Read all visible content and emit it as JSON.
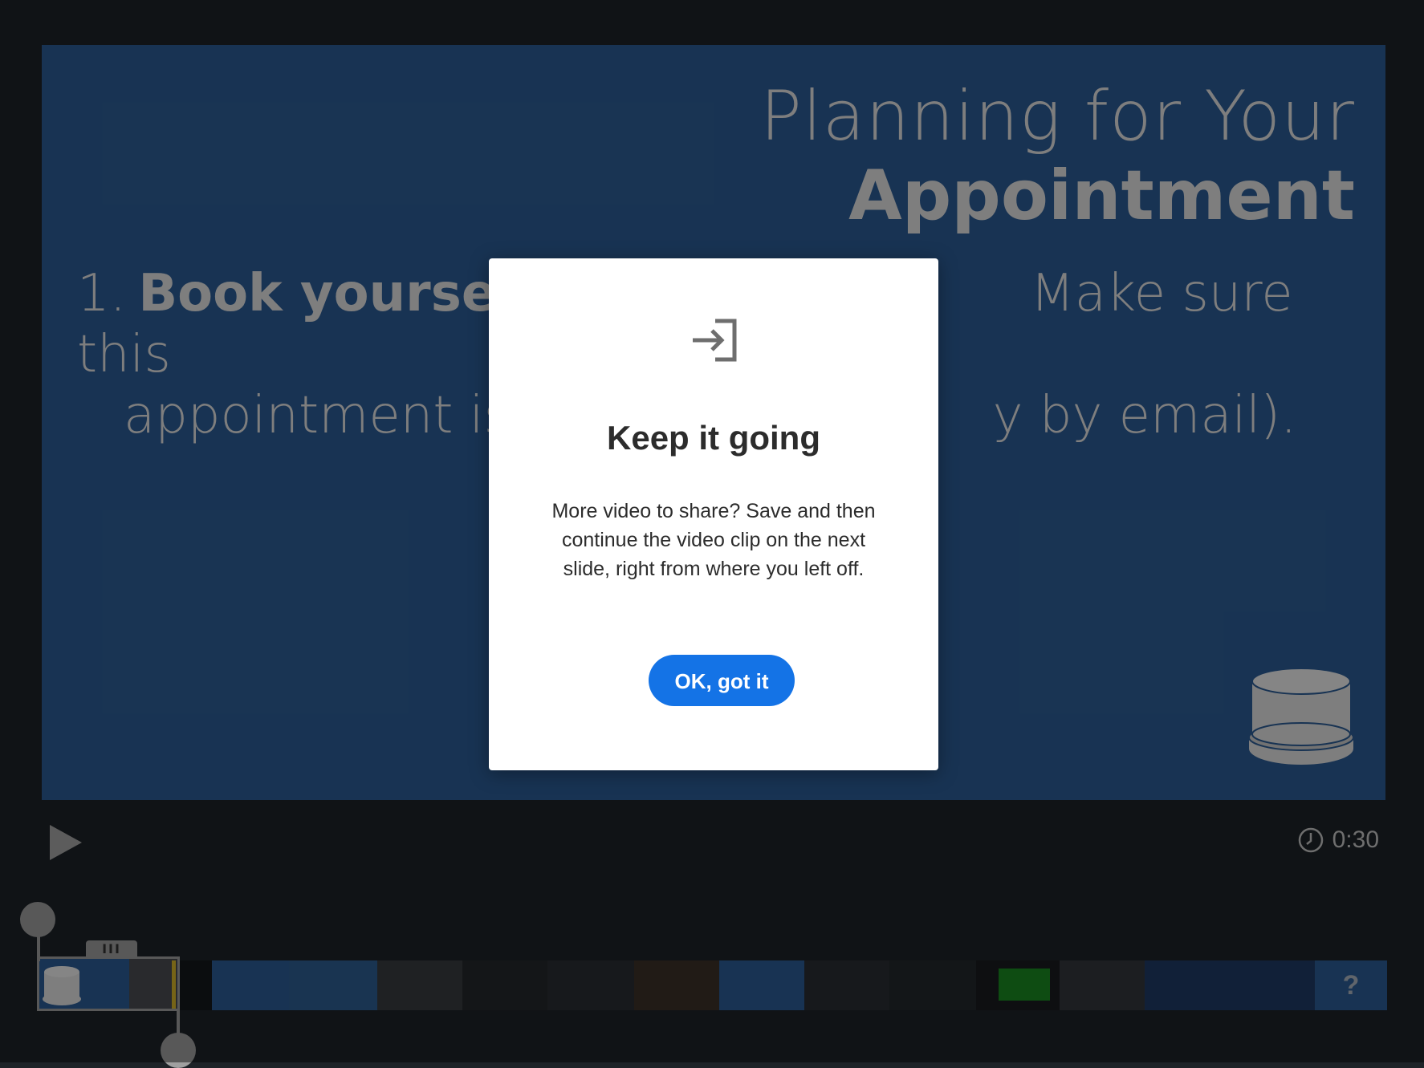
{
  "slide": {
    "title_line1": "Planning for Your",
    "title_line2": "Appointment",
    "item_number": "1.",
    "item_bold": "Book yourself ti",
    "item_rest_line1": "Make sure this",
    "item_line2_left": "appointment is",
    "item_line2_right": "y by email)."
  },
  "dialog": {
    "icon": "enter-icon",
    "title": "Keep it going",
    "message": "More video to share? Save and then continue the video clip on the next slide, right from where you left off.",
    "ok_label": "OK, got it"
  },
  "player": {
    "play_icon": "play-icon",
    "duration_icon": "clock-icon",
    "duration": "0:30"
  },
  "timeline": {
    "selected_clip_handle": "III",
    "help_glyph": "?"
  },
  "colors": {
    "slide_bg": "#2d5e97",
    "button_blue": "#1473e6",
    "app_bg": "#1e2328"
  }
}
